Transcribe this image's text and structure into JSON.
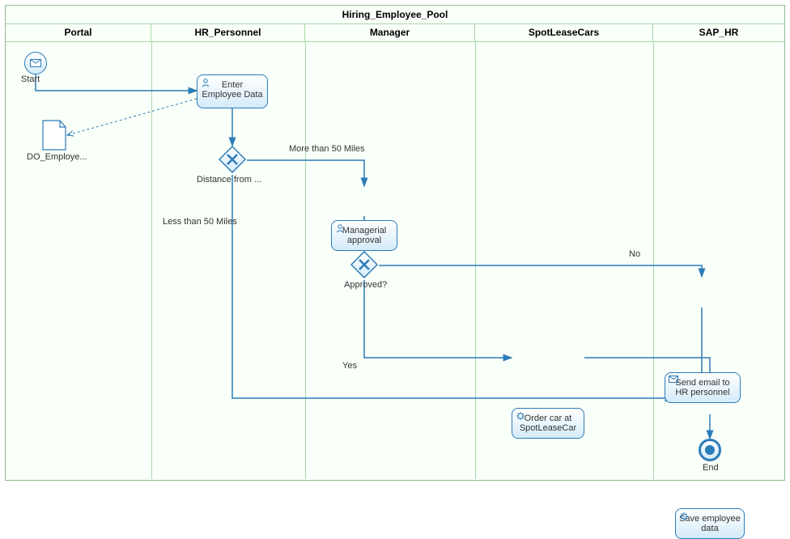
{
  "chart_data": {
    "type": "bpmn-diagram",
    "pool": "Hiring_Employee_Pool",
    "lanes": [
      "Portal",
      "HR_Personnel",
      "Manager",
      "SpotLeaseCars",
      "SAP_HR"
    ],
    "nodes": [
      {
        "id": "start",
        "type": "start-event-message",
        "lane": "Portal",
        "label": "Start"
      },
      {
        "id": "data_emp",
        "type": "data-object",
        "lane": "Portal",
        "label": "DO_Employe..."
      },
      {
        "id": "enter_data",
        "type": "user-task",
        "lane": "HR_Personnel",
        "label": "Enter Employee Data"
      },
      {
        "id": "gw_distance",
        "type": "exclusive-gateway",
        "lane": "HR_Personnel",
        "label": "Distance from ..."
      },
      {
        "id": "mgr_approval",
        "type": "user-task",
        "lane": "Manager",
        "label": "Managerial approval"
      },
      {
        "id": "gw_approved",
        "type": "exclusive-gateway",
        "lane": "Manager",
        "label": "Approved?"
      },
      {
        "id": "order_car",
        "type": "service-task",
        "lane": "SpotLeaseCars",
        "label": "Order car at SpotLeaseCar"
      },
      {
        "id": "send_email",
        "type": "send-task",
        "lane": "SAP_HR",
        "label": "Send email to HR personnel"
      },
      {
        "id": "save_data",
        "type": "service-task",
        "lane": "SAP_HR",
        "label": "Save employee data"
      },
      {
        "id": "end",
        "type": "end-event",
        "lane": "SAP_HR",
        "label": "End"
      }
    ],
    "flows": [
      {
        "from": "start",
        "to": "enter_data"
      },
      {
        "from": "enter_data",
        "to": "data_emp",
        "type": "data-association"
      },
      {
        "from": "enter_data",
        "to": "gw_distance"
      },
      {
        "from": "gw_distance",
        "to": "mgr_approval",
        "label": "More than 50 Miles"
      },
      {
        "from": "gw_distance",
        "to": "save_data",
        "label": "Less than 50 Miles"
      },
      {
        "from": "mgr_approval",
        "to": "gw_approved"
      },
      {
        "from": "gw_approved",
        "to": "send_email",
        "label": "No"
      },
      {
        "from": "gw_approved",
        "to": "order_car",
        "label": "Yes"
      },
      {
        "from": "order_car",
        "to": "save_data"
      },
      {
        "from": "send_email",
        "to": "save_data"
      },
      {
        "from": "save_data",
        "to": "end"
      }
    ]
  },
  "pool_title": "Hiring_Employee_Pool",
  "lanes": {
    "portal": "Portal",
    "hr": "HR_Personnel",
    "manager": "Manager",
    "spotlease": "SpotLeaseCars",
    "sap": "SAP_HR"
  },
  "labels": {
    "start": "Start",
    "data_object": "DO_Employe...",
    "enter_data": "Enter Employee Data",
    "gw_distance": "Distance from ...",
    "mgr_approval": "Managerial approval",
    "gw_approved": "Approved?",
    "order_car": "Order car at SpotLeaseCar",
    "send_email": "Send email to HR personnel",
    "save_data": "Save employee data",
    "end": "End",
    "more_50": "More than 50 Miles",
    "less_50": "Less than 50 Miles",
    "no": "No",
    "yes": "Yes"
  },
  "colors": {
    "border": "#2c7cb8",
    "lane": "#a8d8a8"
  }
}
